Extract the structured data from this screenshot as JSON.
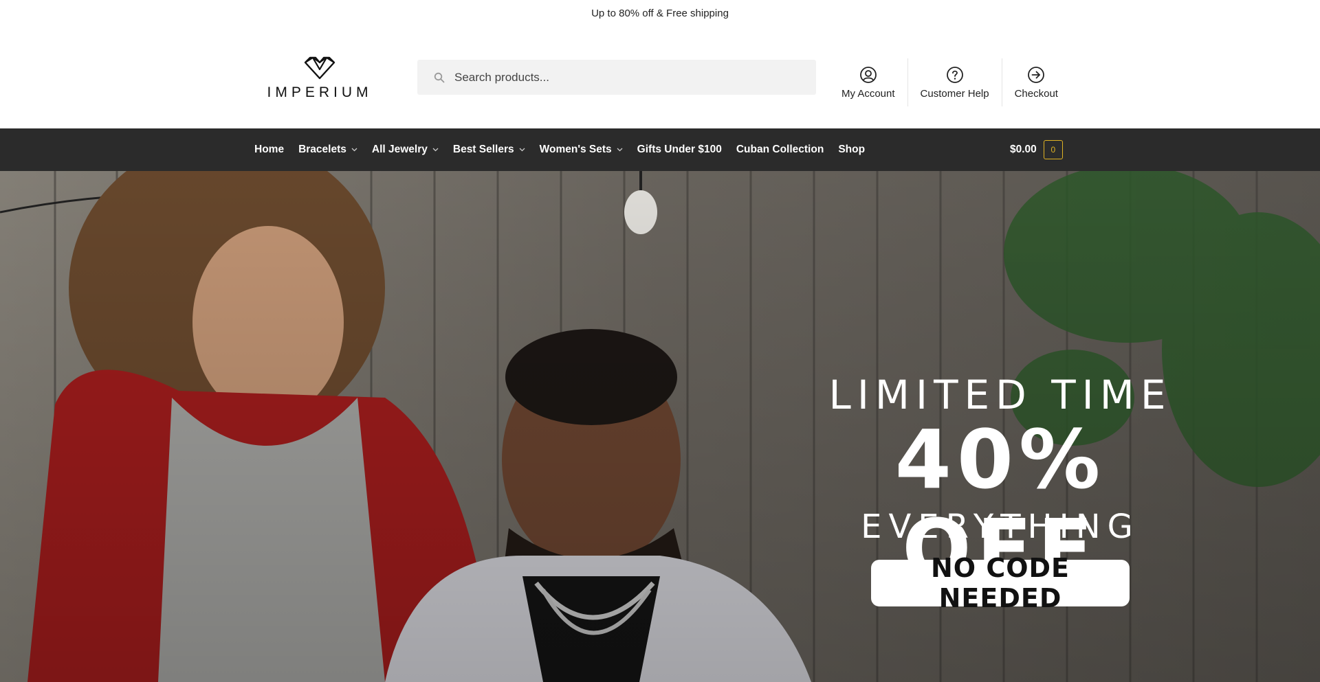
{
  "promo": {
    "text": "Up to 80% off & Free shipping"
  },
  "brand": {
    "name": "IMPERIUM",
    "logo_icon": "double-diamond-icon"
  },
  "search": {
    "placeholder": "Search products...",
    "icon": "search-icon"
  },
  "header_links": [
    {
      "label": "My Account",
      "icon": "user-circle-icon"
    },
    {
      "label": "Customer Help",
      "icon": "help-circle-icon"
    },
    {
      "label": "Checkout",
      "icon": "arrow-right-circle-icon"
    }
  ],
  "nav": {
    "items": [
      {
        "label": "Home",
        "has_dropdown": false
      },
      {
        "label": "Bracelets",
        "has_dropdown": true
      },
      {
        "label": "All Jewelry",
        "has_dropdown": true
      },
      {
        "label": "Best Sellers",
        "has_dropdown": true
      },
      {
        "label": "Women's Sets",
        "has_dropdown": true
      },
      {
        "label": "Gifts Under $100",
        "has_dropdown": false
      },
      {
        "label": "Cuban Collection",
        "has_dropdown": false
      },
      {
        "label": "Shop",
        "has_dropdown": false
      }
    ],
    "cart_total": "$0.00",
    "cart_count": "0"
  },
  "hero": {
    "line1": "LIMITED TIME",
    "line2": "40% OFF",
    "line3": "EVERYTHING",
    "badge": "NO CODE NEEDED"
  },
  "colors": {
    "nav_bg": "#2b2b2b",
    "cart_accent": "#e0b324",
    "search_bg": "#f2f2f2"
  }
}
